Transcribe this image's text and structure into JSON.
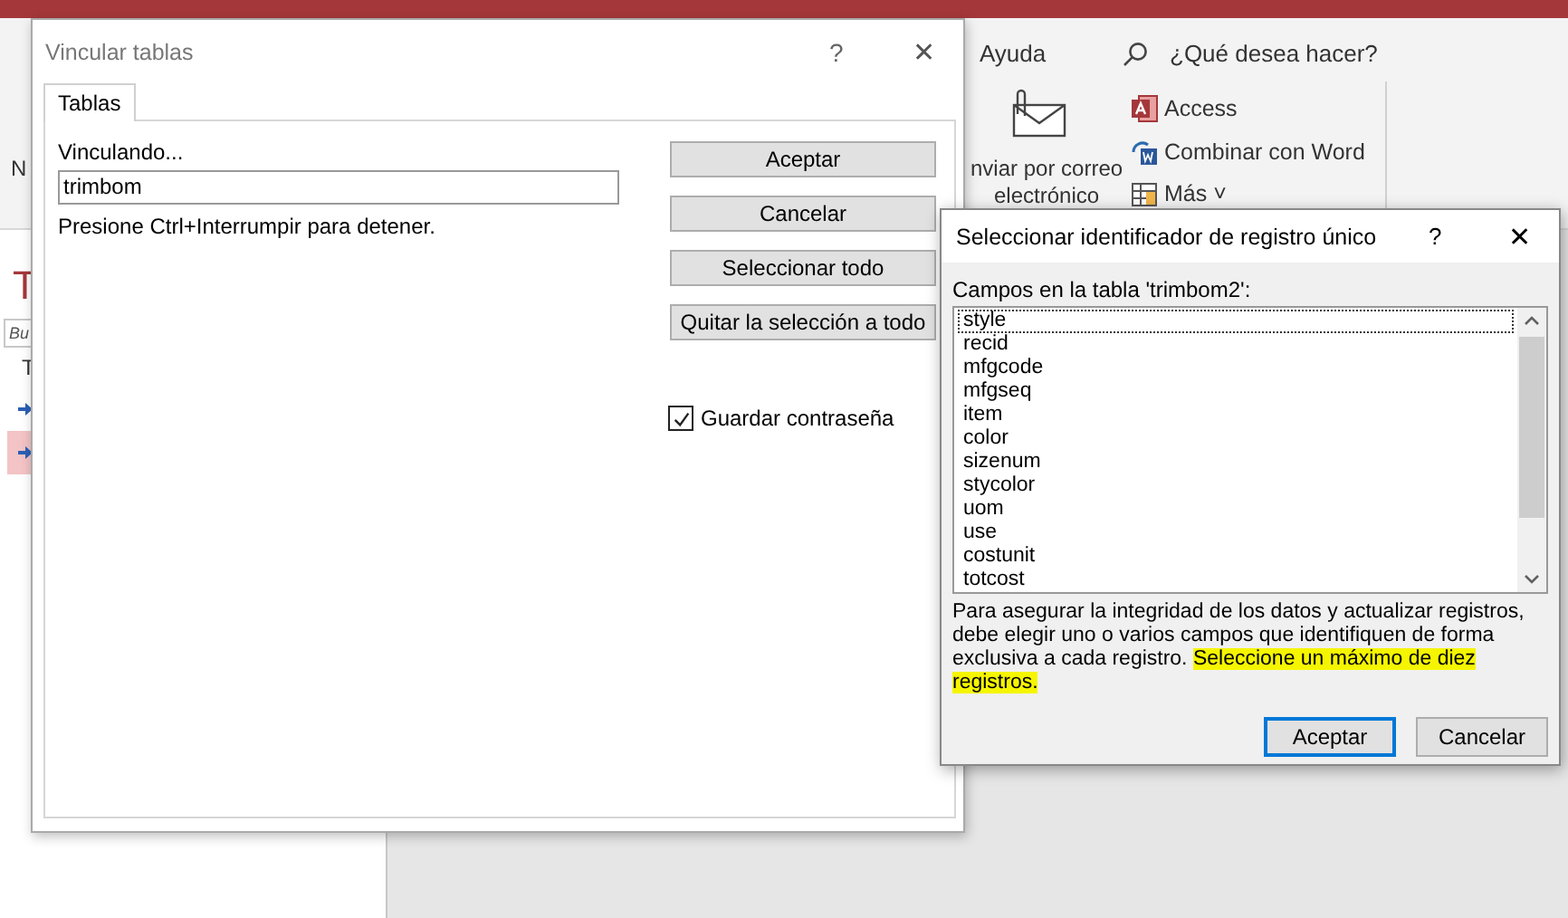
{
  "background_app": {
    "ribbon": {
      "tab_help": "Ayuda",
      "search_placeholder": "¿Qué desea hacer?",
      "left_fragment": "N",
      "email_button": [
        "nviar por correo",
        "electrónico"
      ],
      "access_button": "Access",
      "word_merge_button": "Combinar con Word",
      "more_button": "Más ˅"
    },
    "nav_pane": {
      "title_fragment": "T",
      "search_fragment": "Bu",
      "group_fragment": "T",
      "items": [
        {
          "selected": false
        },
        {
          "selected": true
        }
      ]
    }
  },
  "link_dialog": {
    "title": "Vincular tablas",
    "help": "?",
    "close": "✕",
    "tabs": [
      {
        "label": "Tablas",
        "selected": true
      }
    ],
    "status_label": "Vinculando...",
    "table_field": "trimbom",
    "hint": "Presione Ctrl+Interrumpir para detener.",
    "buttons": [
      "Aceptar",
      "Cancelar",
      "Seleccionar todo",
      "Quitar la selección a todo"
    ],
    "save_password": {
      "label": "Guardar contraseña",
      "checked": true
    }
  },
  "id_dialog": {
    "title": "Seleccionar identificador de registro único",
    "help": "?",
    "close": "✕",
    "list_label": "Campos en la tabla 'trimbom2':",
    "fields": [
      {
        "name": "style",
        "focused": true
      },
      {
        "name": "recid",
        "focused": false
      },
      {
        "name": "mfgcode",
        "focused": false
      },
      {
        "name": "mfgseq",
        "focused": false
      },
      {
        "name": "item",
        "focused": false
      },
      {
        "name": "color",
        "focused": false
      },
      {
        "name": "sizenum",
        "focused": false
      },
      {
        "name": "stycolor",
        "focused": false
      },
      {
        "name": "uom",
        "focused": false
      },
      {
        "name": "use",
        "focused": false
      },
      {
        "name": "costunit",
        "focused": false
      },
      {
        "name": "totcost",
        "focused": false
      }
    ],
    "message": {
      "text": "Para asegurar la integridad de los datos y actualizar registros, debe elegir uno o varios campos que identifiquen de forma exclusiva a cada registro. ",
      "highlighted": "Seleccione un máximo de diez registros."
    },
    "buttons": [
      {
        "label": "Aceptar",
        "default": true
      },
      {
        "label": "Cancelar",
        "default": false
      }
    ]
  }
}
